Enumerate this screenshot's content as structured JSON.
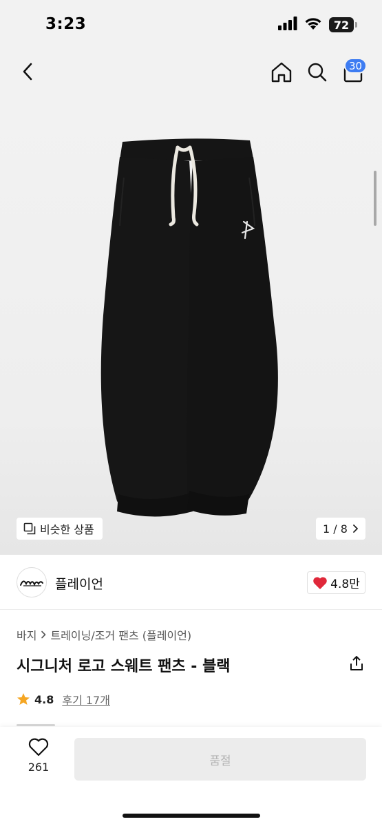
{
  "status_bar": {
    "time": "3:23",
    "battery": "72",
    "icons": [
      "signal-icon",
      "wifi-icon",
      "battery-icon"
    ]
  },
  "nav": {
    "icons": [
      "back-icon",
      "home-icon",
      "search-icon",
      "cart-icon"
    ],
    "cart_badge": "30",
    "badge_color": "#3d7cf2"
  },
  "product_image": {
    "similar_label": "비슷한 상품",
    "page_current": "1",
    "page_total": "8",
    "page_text": "1 / 8"
  },
  "brand": {
    "name": "플레이언",
    "logo_text": "Playian",
    "likes": "4.8만",
    "heart_color": "#e0283a"
  },
  "product": {
    "breadcrumb_parent": "바지",
    "breadcrumb_child": "트레이닝/조거 팬츠 (플레이언)",
    "title": "시그니처 로고 스웨트 팬츠 - 블랙",
    "rating": "4.8",
    "review_text": "후기 17개",
    "star_color": "#f5a623"
  },
  "bottom_bar": {
    "wish_count": "261",
    "buy_label": "품절"
  }
}
